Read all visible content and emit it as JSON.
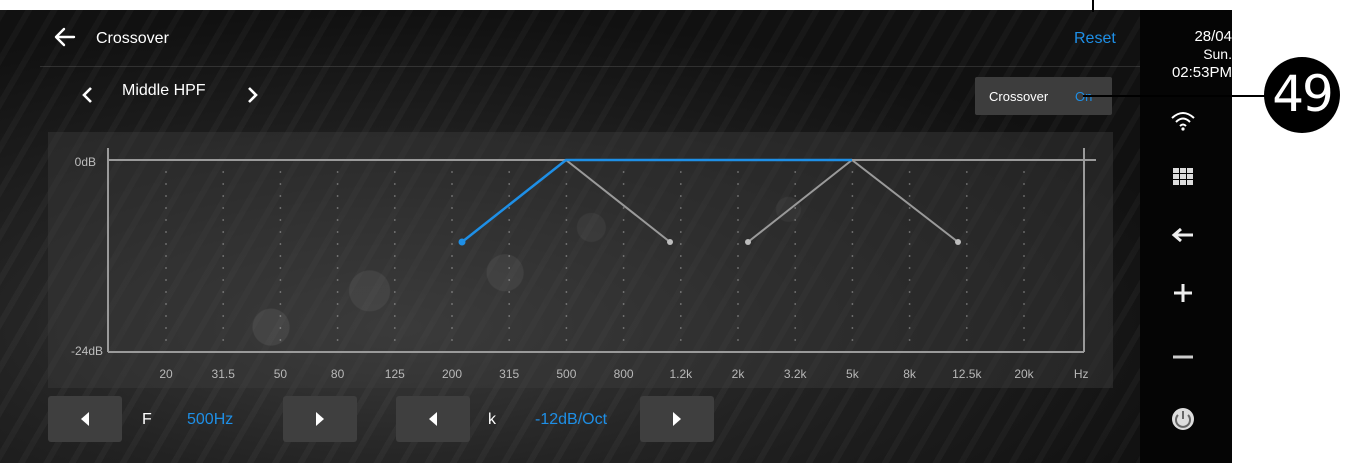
{
  "header": {
    "title": "Crossover",
    "reset_label": "Reset"
  },
  "selector": {
    "current": "Middle HPF"
  },
  "crossover_toggle": {
    "label": "Crossover",
    "state": "On"
  },
  "graph": {
    "db_top": "0dB",
    "db_bottom": "-24dB",
    "freq_labels": [
      "20",
      "31.5",
      "50",
      "80",
      "125",
      "200",
      "315",
      "500",
      "800",
      "1.2k",
      "2k",
      "3.2k",
      "5k",
      "8k",
      "12.5k",
      "20k",
      "Hz"
    ]
  },
  "controls": {
    "f_label": "F",
    "f_value": "500Hz",
    "k_label": "k",
    "k_value": "-12dB/Oct"
  },
  "status": {
    "date": "28/04",
    "day": "Sun.",
    "time": "02:53PM"
  },
  "sidebar_icons": [
    "wifi-icon",
    "apps-grid-icon",
    "back-arrow-icon",
    "volume-up-icon",
    "volume-down-icon",
    "power-icon"
  ],
  "annotation": {
    "number": "49"
  },
  "colors": {
    "accent": "#1e8fe6",
    "line_inactive": "#9a9a9a",
    "button_bg": "#3f3f3f"
  }
}
